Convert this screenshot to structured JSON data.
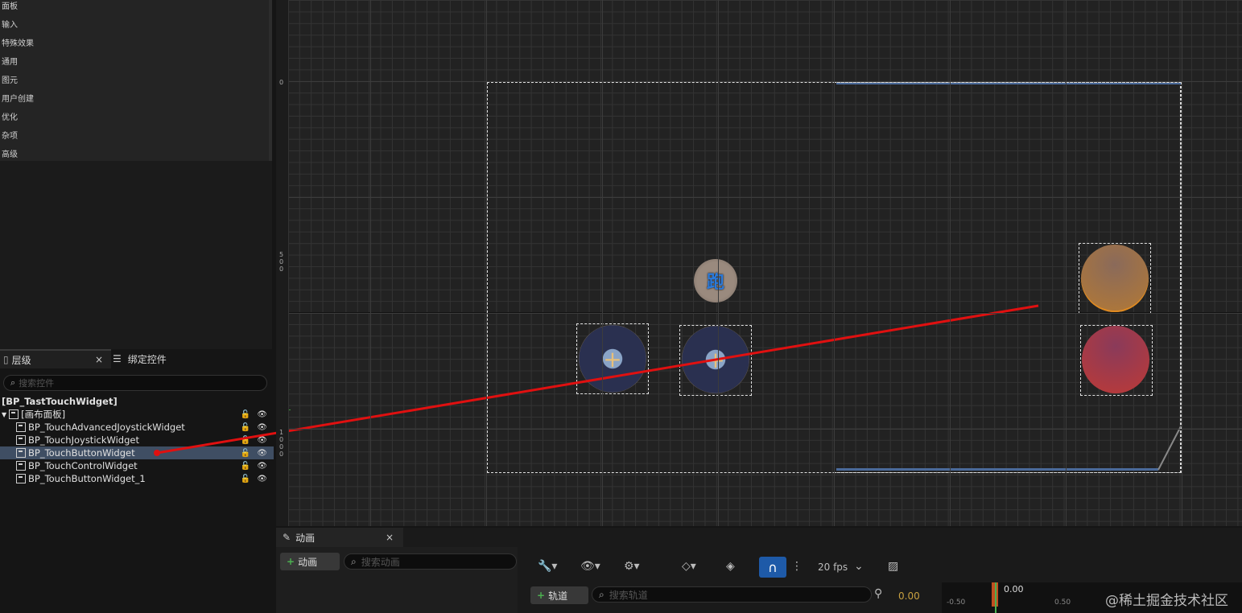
{
  "palette": {
    "categories": [
      "面板",
      "输入",
      "特殊效果",
      "通用",
      "图元",
      "用户创建",
      "优化",
      "杂项",
      "高级"
    ]
  },
  "hierarchy": {
    "tab_label": "层级",
    "tab2_label": "绑定控件",
    "search_placeholder": "搜索控件",
    "root": "[BP_TastTouchWidget]",
    "canvas_panel": "[画布面板]",
    "items": [
      "BP_TouchAdvancedJoystickWidget",
      "BP_TouchJoystickWidget",
      "BP_TouchButtonWidget",
      "BP_TouchControlWidget",
      "BP_TouchButtonWidget_1"
    ],
    "selected_index": 2
  },
  "ruler": {
    "t0": "0",
    "t500": "5\n0\n0",
    "t1000": "1\n0\n0\n0"
  },
  "canvas": {
    "run_button_label": "跑"
  },
  "animation": {
    "tab_label": "动画",
    "add_label": "动画",
    "search_placeholder": "搜索动画",
    "track_label": "轨道",
    "track_search_placeholder": "搜索轨道",
    "fps": "20 fps",
    "current_time": "0.00",
    "playhead_time": "0.00",
    "timeline_ticks": [
      "-0.50",
      "0.50"
    ]
  },
  "watermark": "@稀土掘金技术社区",
  "colors": {
    "selection": "#3f4e63",
    "accent": "#1e5aa8",
    "arrow": "#e01010"
  }
}
